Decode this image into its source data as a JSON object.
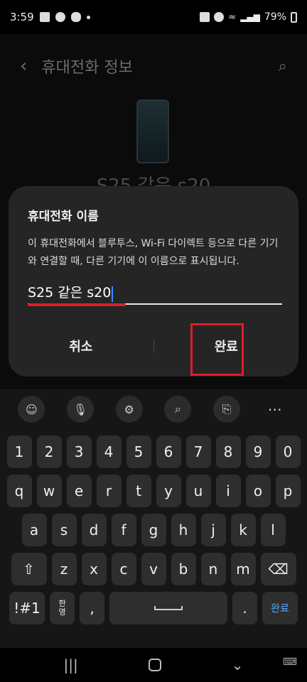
{
  "status_bar": {
    "time": "3:59",
    "battery": "79%"
  },
  "background_page": {
    "title": "휴대전화 정보",
    "device_name": "S25 같은 s20"
  },
  "dialog": {
    "title": "휴대전화 이름",
    "description": "이 휴대전화에서 블루투스, Wi-Fi 다이렉트 등으로 다른 기기와 연결할 때, 다른 기기에 이 이름으로 표시됩니다.",
    "name_value": "S25 같은 s20",
    "cancel_label": "취소",
    "done_label": "완료"
  },
  "keyboard": {
    "row_numbers": [
      "1",
      "2",
      "3",
      "4",
      "5",
      "6",
      "7",
      "8",
      "9",
      "0"
    ],
    "row_top": [
      "q",
      "w",
      "e",
      "r",
      "t",
      "y",
      "u",
      "i",
      "o",
      "p"
    ],
    "row_middle": [
      "a",
      "s",
      "d",
      "f",
      "g",
      "h",
      "j",
      "k",
      "l"
    ],
    "row_bottom": [
      "z",
      "x",
      "c",
      "v",
      "b",
      "n",
      "m"
    ],
    "symbols_label": "!#1",
    "lang_top": "한",
    "lang_bottom": "영",
    "comma_label": ",",
    "period_label": ".",
    "done_label": "완료"
  }
}
